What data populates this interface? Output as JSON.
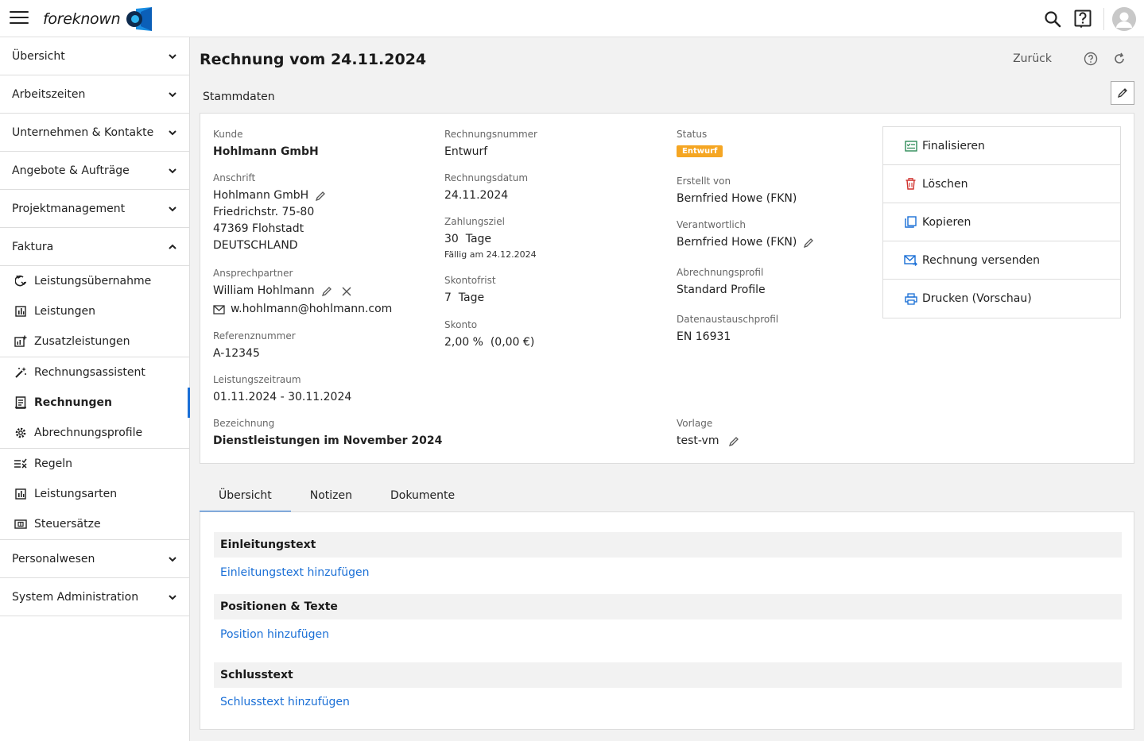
{
  "app": {
    "logo_text": "foreknown"
  },
  "sidebar": {
    "groups_top": [
      {
        "label": "Übersicht"
      },
      {
        "label": "Arbeitszeiten"
      },
      {
        "label": "Unternehmen & Kontakte"
      },
      {
        "label": "Angebote & Aufträge"
      },
      {
        "label": "Projektmanagement"
      },
      {
        "label": "Faktura"
      }
    ],
    "items": [
      {
        "label": "Leistungsübernahme",
        "icon": "import-icon"
      },
      {
        "label": "Leistungen",
        "icon": "chart-icon"
      },
      {
        "label": "Zusatzleistungen",
        "icon": "chart-plus-icon"
      },
      {
        "label": "Rechnungsassistent",
        "icon": "magic-wand-icon"
      },
      {
        "label": "Rechnungen",
        "icon": "invoice-icon"
      },
      {
        "label": "Abrechnungsprofile",
        "icon": "gear-icon"
      },
      {
        "label": "Regeln",
        "icon": "rules-icon"
      },
      {
        "label": "Leistungsarten",
        "icon": "chart-icon"
      },
      {
        "label": "Steuersätze",
        "icon": "money-icon"
      }
    ],
    "groups_bottom": [
      {
        "label": "Personalwesen"
      },
      {
        "label": "System Administration"
      }
    ]
  },
  "header": {
    "title": "Rechnung vom 24.11.2024",
    "back_label": "Zurück",
    "section_label": "Stammdaten"
  },
  "master": {
    "kunde_label": "Kunde",
    "kunde_value": "Hohlmann GmbH",
    "anschrift_label": "Anschrift",
    "anschrift_lines": [
      "Hohlmann GmbH",
      "Friedrichstr. 75-80",
      "47369 Flohstadt",
      "DEUTSCHLAND"
    ],
    "ansprech_label": "Ansprechpartner",
    "ansprech_value": "William Hohlmann",
    "ansprech_email": "w.hohlmann@hohlmann.com",
    "referenz_label": "Referenznummer",
    "referenz_value": "A-12345",
    "zeitraum_label": "Leistungszeitraum",
    "zeitraum_value": "01.11.2024 - 30.11.2024",
    "bezeichnung_label": "Bezeichnung",
    "bezeichnung_value": "Dienstleistungen im November 2024",
    "rnr_label": "Rechnungsnummer",
    "rnr_value": "Entwurf",
    "rdatum_label": "Rechnungsdatum",
    "rdatum_value": "24.11.2024",
    "zahlungsziel_label": "Zahlungsziel",
    "zahlungsziel_value": "30  Tage",
    "faellig": "Fällig am 24.12.2024",
    "skontofrist_label": "Skontofrist",
    "skontofrist_value": "7  Tage",
    "skonto_label": "Skonto",
    "skonto_value": "2,00 %  (0,00 €)",
    "status_label": "Status",
    "status_value": "Entwurf",
    "erstellt_label": "Erstellt von",
    "erstellt_value": "Bernfried Howe (FKN)",
    "verantw_label": "Verantwortlich",
    "verantw_value": "Bernfried Howe (FKN)",
    "abrprofil_label": "Abrechnungsprofil",
    "abrprofil_value": "Standard Profile",
    "datenaus_label": "Datenaustauschprofil",
    "datenaus_value": "EN 16931",
    "vorlage_label": "Vorlage",
    "vorlage_value": "test-vm"
  },
  "actions": [
    {
      "label": "Finalisieren"
    },
    {
      "label": "Löschen"
    },
    {
      "label": "Kopieren"
    },
    {
      "label": "Rechnung versenden"
    },
    {
      "label": "Drucken (Vorschau)"
    }
  ],
  "tabs": [
    {
      "label": "Übersicht"
    },
    {
      "label": "Notizen"
    },
    {
      "label": "Dokumente"
    }
  ],
  "overview": {
    "intro_head": "Einleitungstext",
    "intro_link": "Einleitungstext hinzufügen",
    "pos_head": "Positionen & Texte",
    "pos_link": "Position hinzufügen",
    "end_head": "Schlusstext",
    "end_link": "Schlusstext hinzufügen"
  },
  "colors": {
    "accent": "#1a6fd6",
    "status": "#f5a623",
    "danger": "#d0312d",
    "success": "#2e8b57"
  }
}
